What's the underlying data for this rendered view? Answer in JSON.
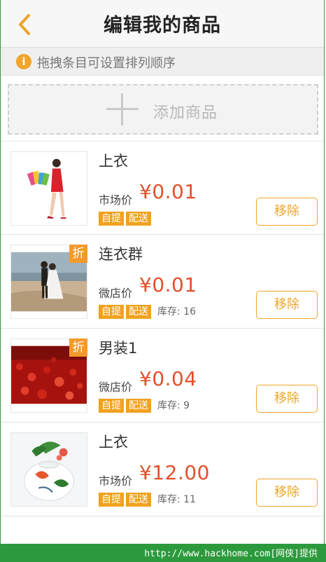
{
  "nav": {
    "title": "编辑我的商品"
  },
  "tip": {
    "text": "拖拽条目可设置排列顺序"
  },
  "add": {
    "label": "添加商品"
  },
  "remove_label": "移除",
  "colors": {
    "accent": "#f0a42a",
    "price": "#e3502a",
    "footer": "#2c9a3c"
  },
  "products": [
    {
      "name": "上衣",
      "price_label": "市场价",
      "price": "¥0.01",
      "tags": [
        "自提",
        "配送"
      ],
      "stock": "",
      "discount": ""
    },
    {
      "name": "连衣群",
      "price_label": "微店价",
      "price": "¥0.01",
      "tags": [
        "自提",
        "配送"
      ],
      "stock": "库存: 16",
      "discount": "折"
    },
    {
      "name": "男装1",
      "price_label": "微店价",
      "price": "¥0.04",
      "tags": [
        "自提",
        "配送"
      ],
      "stock": "库存: 9",
      "discount": "折"
    },
    {
      "name": "上衣",
      "price_label": "市场价",
      "price": "¥12.00",
      "tags": [
        "自提",
        "配送"
      ],
      "stock": "库存: 11",
      "discount": ""
    }
  ],
  "footer": {
    "watermark": "http://www.hackhome.com[网侠]提供"
  }
}
